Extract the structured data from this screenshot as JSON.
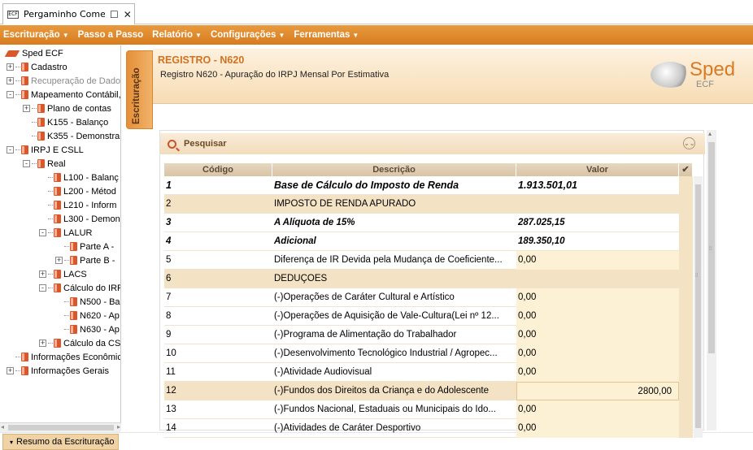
{
  "tab": {
    "title": "Pergaminho Come...",
    "icon_label": "ECF"
  },
  "menu": [
    {
      "label": "Escrituração",
      "has_caret": true
    },
    {
      "label": "Passo a Passo",
      "has_caret": false
    },
    {
      "label": "Relatório",
      "has_caret": true
    },
    {
      "label": "Configurações",
      "has_caret": true
    },
    {
      "label": "Ferramentas",
      "has_caret": true
    }
  ],
  "tree": [
    {
      "label": "Sped ECF",
      "level": 0,
      "exp": "",
      "type": "root"
    },
    {
      "label": "Cadastro",
      "level": 0,
      "exp": "+",
      "type": "book"
    },
    {
      "label": "Recuperação de Dados",
      "level": 0,
      "exp": "+",
      "type": "book",
      "disabled": true
    },
    {
      "label": "Mapeamento Contábil,",
      "level": 0,
      "exp": "-",
      "type": "book"
    },
    {
      "label": "Plano de contas",
      "level": 1,
      "exp": "+",
      "type": "book"
    },
    {
      "label": "K155 - Balanço",
      "level": 1,
      "exp": "",
      "type": "book"
    },
    {
      "label": "K355 - Demonstra",
      "level": 1,
      "exp": "",
      "type": "book"
    },
    {
      "label": "IRPJ E CSLL",
      "level": 0,
      "exp": "-",
      "type": "book"
    },
    {
      "label": "Real",
      "level": 1,
      "exp": "-",
      "type": "book"
    },
    {
      "label": "L100 - Balanç",
      "level": 2,
      "exp": "",
      "type": "book"
    },
    {
      "label": "L200 - Métod",
      "level": 2,
      "exp": "",
      "type": "book"
    },
    {
      "label": "L210 - Inform",
      "level": 2,
      "exp": "",
      "type": "book"
    },
    {
      "label": "L300 - Demon",
      "level": 2,
      "exp": "",
      "type": "book"
    },
    {
      "label": "LALUR",
      "level": 2,
      "exp": "-",
      "type": "book"
    },
    {
      "label": "Parte A -",
      "level": 3,
      "exp": "",
      "type": "book"
    },
    {
      "label": "Parte B -",
      "level": 3,
      "exp": "+",
      "type": "book"
    },
    {
      "label": "LACS",
      "level": 2,
      "exp": "+",
      "type": "book"
    },
    {
      "label": "Cálculo do IRP",
      "level": 2,
      "exp": "-",
      "type": "book"
    },
    {
      "label": "N500 - Ba",
      "level": 3,
      "exp": "",
      "type": "book"
    },
    {
      "label": "N620 - Ap",
      "level": 3,
      "exp": "",
      "type": "book"
    },
    {
      "label": "N630 - Ap",
      "level": 3,
      "exp": "",
      "type": "book"
    },
    {
      "label": "Cálculo da CS",
      "level": 2,
      "exp": "+",
      "type": "book"
    },
    {
      "label": "Informações Econômic",
      "level": 0,
      "exp": "",
      "type": "book"
    },
    {
      "label": "Informações Gerais",
      "level": 0,
      "exp": "+",
      "type": "book"
    }
  ],
  "bottom_tab": {
    "label": "Resumo da Escrituração"
  },
  "side_tab": {
    "label": "Escrituração"
  },
  "header": {
    "title": "REGISTRO - N620",
    "subtitle": "Registro N620 - Apuração do IRPJ Mensal Por Estimativa",
    "logo_main": "Sped",
    "logo_sub": "ECF"
  },
  "search": {
    "label": "Pesquisar"
  },
  "grid": {
    "columns": {
      "code": "Código",
      "desc": "Descrição",
      "value": "Valor"
    },
    "rows": [
      {
        "code": "1",
        "desc": "Base de Cálculo do Imposto de Renda",
        "value": "1.913.501,01",
        "style": "bold big",
        "edit": false
      },
      {
        "code": "2",
        "desc": "IMPOSTO DE RENDA APURADO",
        "value": "",
        "style": "hl",
        "edit": false
      },
      {
        "code": "3",
        "desc": "A Alíquota de 15%",
        "value": "287.025,15",
        "style": "bi",
        "edit": false
      },
      {
        "code": "4",
        "desc": "Adicional",
        "value": "189.350,10",
        "style": "bi",
        "edit": false
      },
      {
        "code": "5",
        "desc": "Diferença de IR Devida pela Mudança de Coeficiente...",
        "value": "0,00",
        "style": "",
        "edit": true
      },
      {
        "code": "6",
        "desc": "DEDUÇÕES",
        "value": "",
        "style": "hl",
        "edit": false
      },
      {
        "code": "7",
        "desc": "(-)Operações de Caráter Cultural e Artístico",
        "value": "0,00",
        "style": "",
        "edit": true
      },
      {
        "code": "8",
        "desc": "(-)Operações de Aquisição de Vale-Cultura(Lei nº 12...",
        "value": "0,00",
        "style": "",
        "edit": true
      },
      {
        "code": "9",
        "desc": "(-)Programa de Alimentação do Trabalhador",
        "value": "0,00",
        "style": "",
        "edit": true
      },
      {
        "code": "10",
        "desc": "(-)Desenvolvimento Tecnológico Industrial / Agropec...",
        "value": "0,00",
        "style": "",
        "edit": true
      },
      {
        "code": "11",
        "desc": "(-)Atividade Audiovisual",
        "value": "0,00",
        "style": "",
        "edit": true
      },
      {
        "code": "12",
        "desc": "(-)Fundos dos Direitos da Criança e do Adolescente",
        "value": "2800,00",
        "style": "hl",
        "edit": true,
        "active": true
      },
      {
        "code": "13",
        "desc": "(-)Fundos Nacional, Estaduais ou Municipais do Ido...",
        "value": "0,00",
        "style": "",
        "edit": true
      },
      {
        "code": "14",
        "desc": "(-)Atividades de Caráter Desportivo",
        "value": "0,00",
        "style": "",
        "edit": true
      }
    ]
  },
  "colors": {
    "accent": "#d97a24",
    "menu_bg": "#e0862a",
    "highlight": "#f3e2c4"
  }
}
